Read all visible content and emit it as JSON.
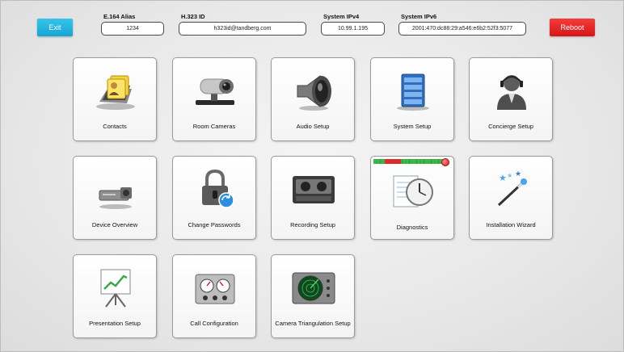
{
  "header": {
    "exit_label": "Exit",
    "reboot_label": "Reboot",
    "fields": {
      "e164": {
        "label": "E.164 Alias",
        "value": "1234"
      },
      "h323": {
        "label": "H.323 ID",
        "value": "h323id@tandberg.com"
      },
      "ipv4": {
        "label": "System IPv4",
        "value": "10.99.1.195"
      },
      "ipv6": {
        "label": "System IPv6",
        "value": "2001:470:dc88:29:a546:e6b2:52f3:5077"
      }
    }
  },
  "tiles": [
    {
      "label": "Contacts",
      "icon": "rolodex-icon"
    },
    {
      "label": "Room Cameras",
      "icon": "camera-icon"
    },
    {
      "label": "Audio Setup",
      "icon": "speaker-icon"
    },
    {
      "label": "System Setup",
      "icon": "server-icon"
    },
    {
      "label": "Concierge Setup",
      "icon": "headset-person-icon"
    },
    {
      "label": "Device Overview",
      "icon": "device-icon"
    },
    {
      "label": "Change Passwords",
      "icon": "lock-icon"
    },
    {
      "label": "Recording Setup",
      "icon": "tape-recorder-icon"
    },
    {
      "label": "Diagnostics",
      "icon": "clock-notepad-icon"
    },
    {
      "label": "Installation Wizard",
      "icon": "magic-wand-icon"
    },
    {
      "label": "Presentation Setup",
      "icon": "presentation-board-icon"
    },
    {
      "label": "Call Configuration",
      "icon": "gauges-icon"
    },
    {
      "label": "Camera Triangulation Setup",
      "icon": "radar-icon"
    }
  ],
  "colors": {
    "exit": "#1aa9d8",
    "reboot": "#e02424",
    "status_green": "#3ab54a",
    "status_red": "#e02a2a"
  }
}
